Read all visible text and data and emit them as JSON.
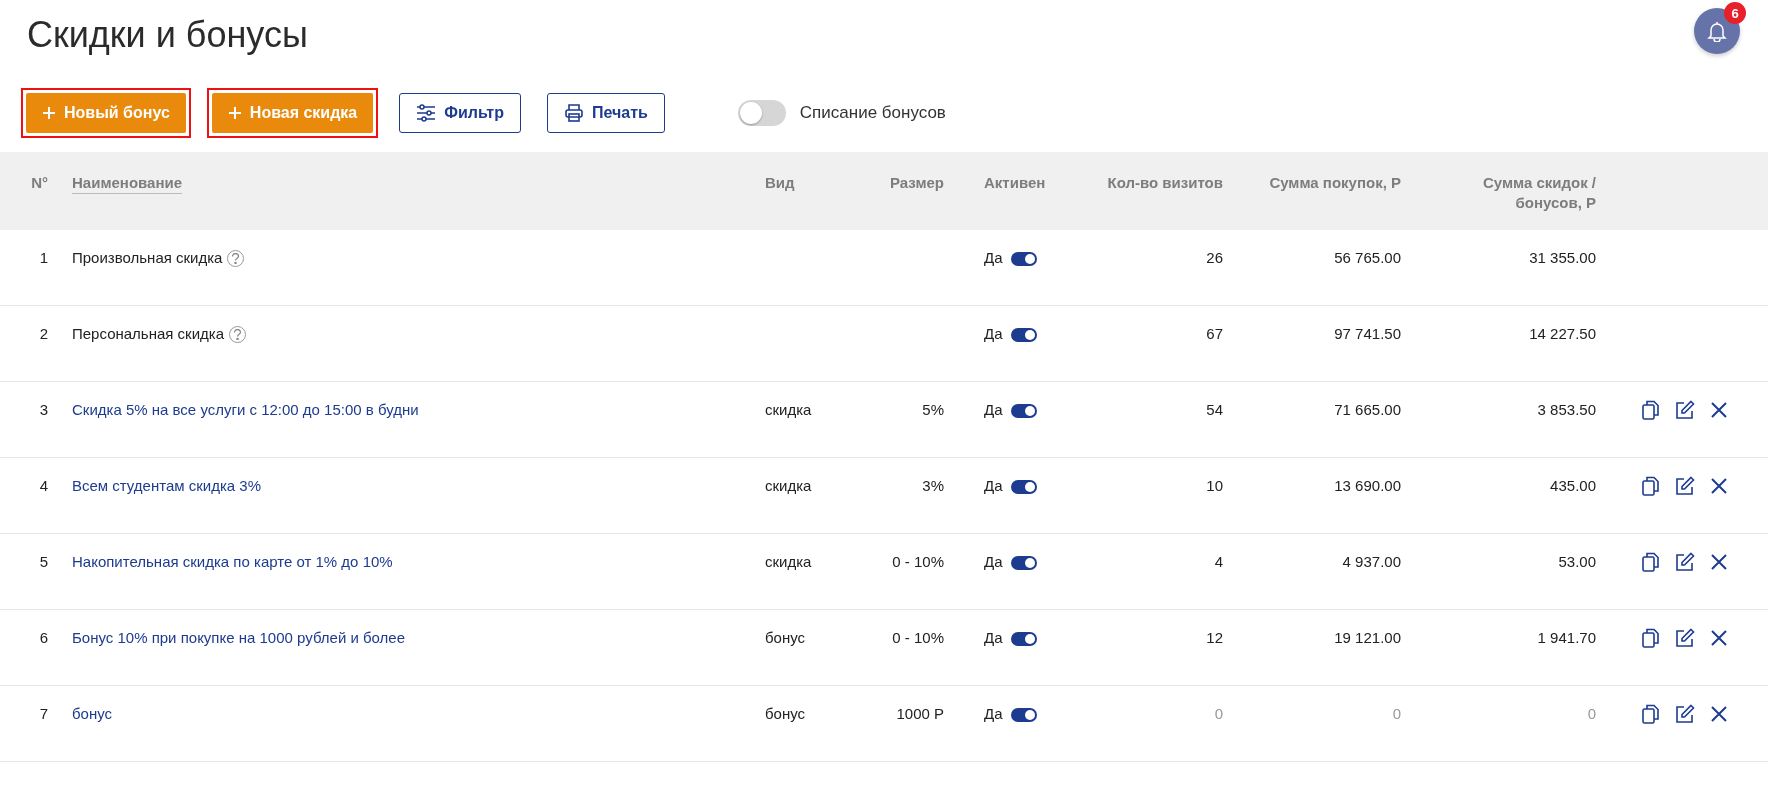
{
  "title": "Скидки и бонусы",
  "notifications": {
    "count": "6"
  },
  "toolbar": {
    "buttons": [
      {
        "kind": "add",
        "label": "Новый бонус",
        "highlighted": true
      },
      {
        "kind": "add",
        "label": "Новая скидка",
        "highlighted": true
      },
      {
        "kind": "filter",
        "label": "Фильтр",
        "highlighted": false
      },
      {
        "kind": "print",
        "label": "Печать",
        "highlighted": false
      }
    ],
    "toggle": {
      "label": "Списание бонусов",
      "on": false
    }
  },
  "table": {
    "columns": [
      "N°",
      "Наименование",
      "Вид",
      "Размер",
      "Активен",
      "Кол-во визитов",
      "Сумма покупок, Р",
      "Сумма скидок / бонусов, Р"
    ],
    "rows": [
      {
        "kind": "builtin",
        "number": "1",
        "name": "Произвольная скидка",
        "type": "",
        "size": "",
        "active_label": "Да",
        "active": true,
        "visits": "26",
        "purchases": "56 765.00",
        "discounts": "31 355.00",
        "empty": false
      },
      {
        "kind": "builtin",
        "number": "2",
        "name": "Персональная скидка",
        "type": "",
        "size": "",
        "active_label": "Да",
        "active": true,
        "visits": "67",
        "purchases": "97 741.50",
        "discounts": "14 227.50",
        "empty": false
      },
      {
        "kind": "custom",
        "number": "3",
        "name": "Скидка 5% на все услуги с 12:00 до 15:00 в будни",
        "type": "скидка",
        "size": "5%",
        "active_label": "Да",
        "active": true,
        "visits": "54",
        "purchases": "71 665.00",
        "discounts": "3 853.50",
        "empty": false
      },
      {
        "kind": "custom",
        "number": "4",
        "name": "Всем студентам скидка 3%",
        "type": "скидка",
        "size": "3%",
        "active_label": "Да",
        "active": true,
        "visits": "10",
        "purchases": "13 690.00",
        "discounts": "435.00",
        "empty": false
      },
      {
        "kind": "custom",
        "number": "5",
        "name": "Накопительная скидка по карте от 1% до 10%",
        "type": "скидка",
        "size": "0 - 10%",
        "active_label": "Да",
        "active": true,
        "visits": "4",
        "purchases": "4 937.00",
        "discounts": "53.00",
        "empty": false
      },
      {
        "kind": "custom",
        "number": "6",
        "name": "Бонус 10% при покупке на 1000 рублей и более",
        "type": "бонус",
        "size": "0 - 10%",
        "active_label": "Да",
        "active": true,
        "visits": "12",
        "purchases": "19 121.00",
        "discounts": "1 941.70",
        "empty": false
      },
      {
        "kind": "custom",
        "number": "7",
        "name": "бонус",
        "type": "бонус",
        "size": "1000 Р",
        "active_label": "Да",
        "active": true,
        "visits": "0",
        "purchases": "0",
        "discounts": "0",
        "empty": true
      }
    ]
  }
}
